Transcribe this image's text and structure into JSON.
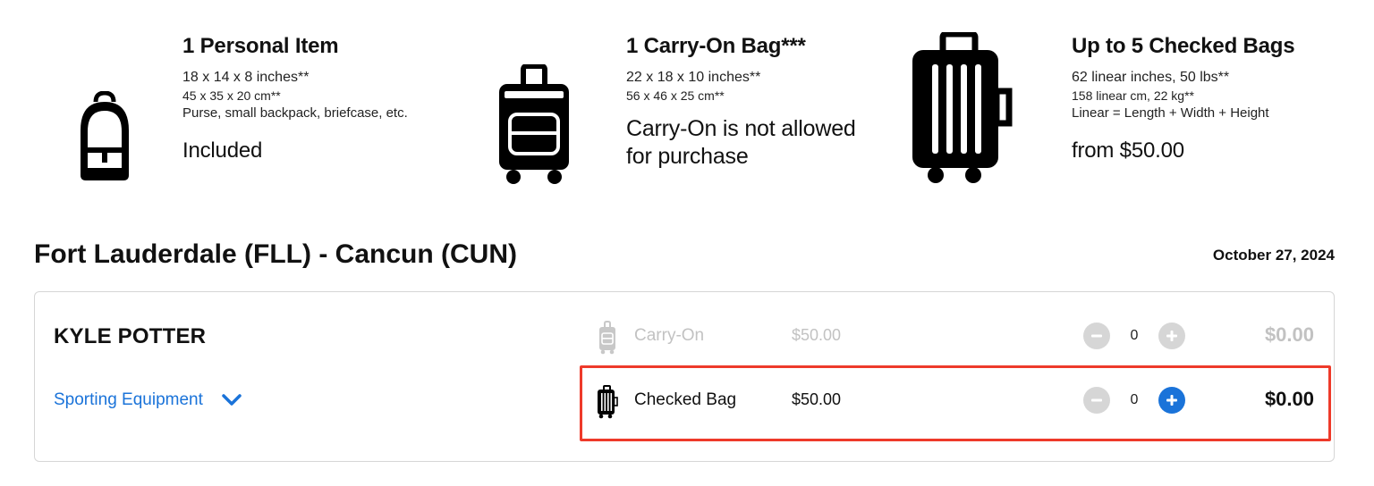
{
  "bag_options": {
    "personal": {
      "title": "1 Personal Item",
      "dim_in": "18 x 14 x 8 inches**",
      "dim_cm": "45 x 35 x 20 cm**",
      "note": "Purse, small backpack, briefcase, etc.",
      "price": "Included",
      "icon": "backpack-icon"
    },
    "carry_on": {
      "title": "1 Carry-On Bag***",
      "dim_in": "22 x 18 x 10 inches**",
      "dim_cm": "56 x 46 x 25 cm**",
      "warning_line1": "Carry-On is not allowed",
      "warning_line2": "for purchase",
      "icon": "carry-on-suitcase-icon"
    },
    "checked": {
      "title": "Up to 5 Checked Bags",
      "dim_in": "62 linear inches, 50 lbs**",
      "dim_cm": "158 linear cm, 22 kg**",
      "note": "Linear = Length + Width + Height",
      "price": "from $50.00",
      "icon": "checked-suitcase-icon"
    }
  },
  "route": {
    "title": "Fort Lauderdale (FLL) - Cancun (CUN)",
    "date": "October 27, 2024"
  },
  "passenger": {
    "name": "KYLE POTTER",
    "sporting_label": "Sporting Equipment",
    "rows": [
      {
        "label": "Carry-On",
        "price": "$50.00",
        "count": "0",
        "total": "$0.00",
        "enabled": false,
        "icon": "carry-on-icon"
      },
      {
        "label": "Checked Bag",
        "price": "$50.00",
        "count": "0",
        "total": "$0.00",
        "enabled": true,
        "icon": "checked-bag-icon"
      }
    ]
  },
  "colors": {
    "link": "#1a73d9",
    "highlight": "#ee3a2a",
    "disabled": "#c2c2c2",
    "plus_active": "#1a73d9",
    "minus_inactive": "#d0d0d0"
  }
}
